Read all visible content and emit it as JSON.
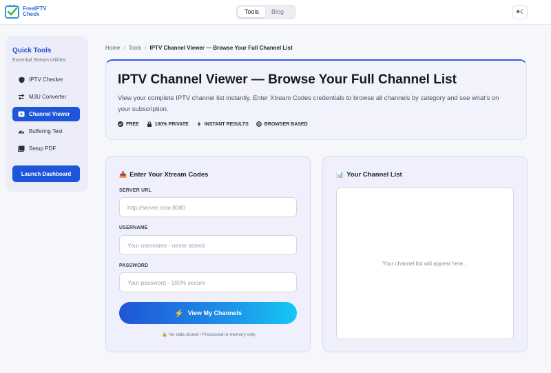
{
  "brand": {
    "line1": "FreeIPTV",
    "line2": "Check"
  },
  "nav": {
    "tabs": [
      {
        "label": "Tools",
        "active": true
      },
      {
        "label": "Blog",
        "active": false
      }
    ],
    "theme_toggle": "☀☾"
  },
  "sidebar": {
    "title": "Quick Tools",
    "subtitle": "Essential Stream Utilities",
    "items": [
      {
        "label": "IPTV Checker",
        "icon": "shield-icon"
      },
      {
        "label": "M3U Converter",
        "icon": "swap-arrows-icon"
      },
      {
        "label": "Channel Viewer",
        "icon": "play-screen-icon",
        "active": true
      },
      {
        "label": "Buffering Test",
        "icon": "gauge-icon"
      },
      {
        "label": "Setup PDF",
        "icon": "document-icon"
      }
    ],
    "cta": "Launch Dashboard"
  },
  "breadcrumb": {
    "home": "Home",
    "tools": "Tools",
    "current": "IPTV Channel Viewer — Browse Your Full Channel List"
  },
  "hero": {
    "title": "IPTV Channel Viewer — Browse Your Full Channel List",
    "description": "View your complete IPTV channel list instantly. Enter Xtream Codes credentials to browse all channels by category and see what's on your subscription.",
    "badges": [
      {
        "label": "FREE",
        "icon": "check-circle-icon"
      },
      {
        "label": "100% PRIVATE",
        "icon": "lock-icon"
      },
      {
        "label": "INSTANT RESULTS",
        "icon": "bolt-icon"
      },
      {
        "label": "BROWSER BASED",
        "icon": "globe-icon"
      }
    ]
  },
  "form": {
    "title_icon": "📥",
    "title": "Enter Your Xtream Codes",
    "server_label": "SERVER URL",
    "server_placeholder": "http://server.com:8080",
    "username_label": "USERNAME",
    "username_placeholder": "Your username - never stored",
    "password_label": "PASSWORD",
    "password_placeholder": "Your password - 100% secure",
    "submit_icon": "⚡",
    "submit": "View My Channels",
    "note": "🔒 No data stored • Processed in-memory only"
  },
  "channel_list": {
    "title_icon": "📊",
    "title": "Your Channel List",
    "empty": "Your channel list will appear here..."
  },
  "colors": {
    "accent": "#1f55d8",
    "gradient_end": "#14c8f4",
    "brand": "#2f6fd6"
  }
}
